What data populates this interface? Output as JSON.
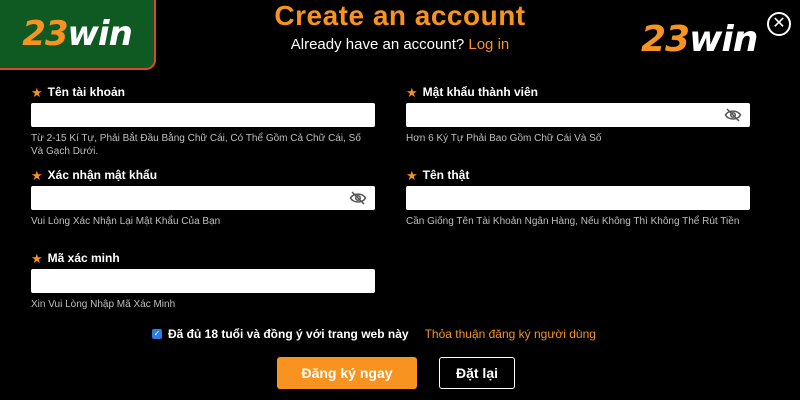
{
  "brand": {
    "logo_number": "23",
    "logo_word": "win"
  },
  "header": {
    "title": "Create an account",
    "subtitle_text": "Already have an account?",
    "login_link": "Log in"
  },
  "form": {
    "username": {
      "label": "Tên tài khoản",
      "hint": "Từ 2-15 Kí Tự, Phải Bắt Đầu Bằng Chữ Cái, Có Thể Gồm Cả Chữ Cái, Số Và Gạch Dưới."
    },
    "password": {
      "label": "Mật khẩu thành viên",
      "hint": "Hơn 6 Ký Tự Phải Bao Gồm Chữ Cái Và Số"
    },
    "confirm_password": {
      "label": "Xác nhận mật khẩu",
      "hint": "Vui Lòng Xác Nhận Lại Mật Khẩu Của Bạn"
    },
    "real_name": {
      "label": "Tên thật",
      "hint": "Cần Giống Tên Tài Khoản Ngân Hàng, Nếu Không Thì Không Thể Rút Tiền"
    },
    "verification_code": {
      "label": "Mã xác minh",
      "hint": "Xin Vui Lòng Nhập Mã Xác Minh"
    }
  },
  "agreement": {
    "checked": true,
    "text": "Đã đủ 18 tuổi và đồng ý với trang web này",
    "terms_link": "Thỏa thuận đăng ký người dùng"
  },
  "actions": {
    "register_label": "Đăng ký ngay",
    "reset_label": "Đặt lại"
  },
  "colors": {
    "accent": "#f7931e",
    "badge_bg": "#0f5a23",
    "checkbox": "#2d7ae0"
  },
  "icons": {
    "close": "close-icon",
    "eye": "eye-slash-icon",
    "star": "star-icon",
    "check": "check-icon"
  }
}
